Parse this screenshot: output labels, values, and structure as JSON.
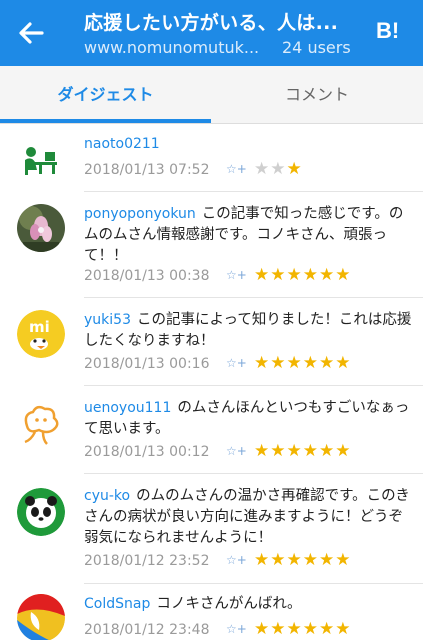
{
  "header": {
    "title": "応援したい方がいる、人は...",
    "url": "www.nomunomutuk...",
    "users": "24 users",
    "brand": "B!",
    "color": "#1e8ae6"
  },
  "tabs": [
    {
      "label": "ダイジェスト",
      "active": true
    },
    {
      "label": "コメント",
      "active": false
    }
  ],
  "comments": [
    {
      "user": "naoto0211",
      "text": "",
      "date": "2018/01/13 07:52",
      "stars": 1,
      "star_slots": 3,
      "avatar_icon": "person-at-desk-icon"
    },
    {
      "user": "ponyoponyokun",
      "text": "この記事で知った感じです。のムのムさん情報感謝です。コノキさん、頑張って！！",
      "date": "2018/01/13 00:38",
      "stars": 6,
      "star_slots": 6,
      "avatar_icon": "flower-photo-icon"
    },
    {
      "user": "yuki53",
      "text": "この記事によって知りました！これは応援したくなりますね！",
      "date": "2018/01/13 00:16",
      "stars": 6,
      "star_slots": 6,
      "avatar_icon": "chick-icon"
    },
    {
      "user": "uenoyou111",
      "text": "のムさんほんといつもすごいなぁって思います。",
      "date": "2018/01/13 00:12",
      "stars": 6,
      "star_slots": 6,
      "avatar_icon": "cloud-character-icon"
    },
    {
      "user": "cyu-ko",
      "text": "のムのムさんの温かさ再確認です。このきさんの病状が良い方向に進みますように！どうぞ弱気になられませんように！",
      "date": "2018/01/12 23:52",
      "stars": 6,
      "star_slots": 6,
      "avatar_icon": "panda-icon"
    },
    {
      "user": "ColdSnap",
      "text": "コノキさんがんばれ。",
      "date": "2018/01/12 23:48",
      "stars": 6,
      "star_slots": 6,
      "avatar_icon": "colorful-logo-icon"
    }
  ],
  "add_star_label": "☆+"
}
